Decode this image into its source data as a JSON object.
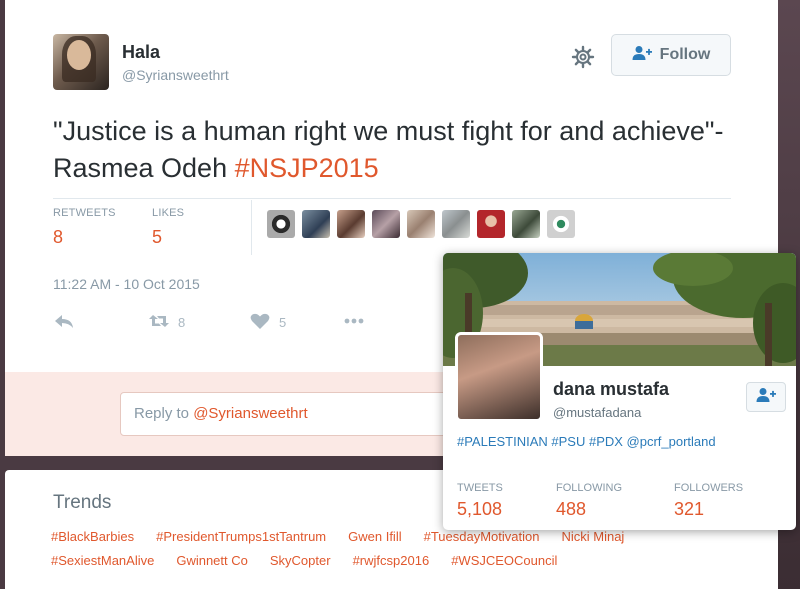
{
  "tweet": {
    "author_name": "Hala",
    "author_handle": "@Syriansweethrt",
    "follow_label": "Follow",
    "text_main": "\"Justice is a human right we must fight for and achieve\"- Rasmea Odeh ",
    "hashtag": "#NSJP2015",
    "retweets_label": "RETWEETS",
    "retweets_count": "8",
    "likes_label": "LIKES",
    "likes_count": "5",
    "timestamp": "11:22 AM - 10 Oct 2015",
    "actions": {
      "retweet_count": "8",
      "like_count": "5"
    },
    "icons": [
      "gear-icon",
      "follow-person-icon",
      "reply-icon",
      "retweet-icon",
      "heart-icon",
      "more-icon"
    ],
    "accent_color": "#e0582d"
  },
  "reply": {
    "prefix": "Reply to ",
    "mention": "@Syriansweethrt"
  },
  "trends": {
    "title": "Trends",
    "row1": [
      "#BlackBarbies",
      "#PresidentTrumps1stTantrum",
      "Gwen Ifill",
      "#TuesdayMotivation",
      "Nicki Minaj"
    ],
    "row2": [
      "#SexiestManAlive",
      "Gwinnett Co",
      "SkyCopter",
      "#rwjfcsp2016",
      "#WSJCEOCouncil"
    ]
  },
  "profile_card": {
    "name": "dana mustafa",
    "handle": "@mustafadana",
    "bio": "#PALESTINIAN #PSU #PDX @pcrf_portland",
    "tweets_label": "TWEETS",
    "tweets_count": "5,108",
    "following_label": "FOLLOWING",
    "following_count": "488",
    "followers_label": "FOLLOWERS",
    "followers_count": "321"
  }
}
